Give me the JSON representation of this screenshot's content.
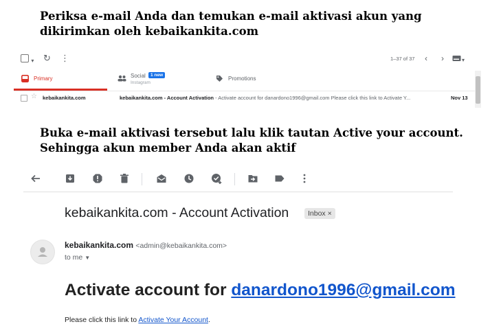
{
  "instructions": {
    "step1": "Periksa e-mail Anda dan temukan e-mail aktivasi akun yang dikirimkan oleh kebaikankita.com",
    "step2": "Buka e-mail aktivasi tersebut lalu klik tautan Active your account. Sehingga akun member Anda akan aktif"
  },
  "inbox": {
    "pagination": "1–37 of 37",
    "tabs": [
      {
        "label": "Primary"
      },
      {
        "label": "Social",
        "badge": "1 new",
        "sublabel": "Instagram"
      },
      {
        "label": "Promotions"
      }
    ],
    "row": {
      "sender": "kebaikankita.com",
      "subject": "kebaikankita.com - Account Activation",
      "snippet": " - Activate account for danardono1996@gmail.com Please click this link to Activate Y...",
      "date": "Nov 13"
    },
    "colors": {
      "primary_tab": "#d93025",
      "badge": "#1a73e8"
    }
  },
  "email": {
    "subject": "kebaikankita.com - Account Activation",
    "label": "Inbox",
    "label_close": "×",
    "sender_name": "kebaikankita.com",
    "sender_email": "<admin@kebaikankita.com>",
    "to": "to me",
    "headline_prefix": "Activate account for ",
    "headline_email": "danardono1996@gmail.com",
    "body_prefix": "Please click this link to ",
    "body_link": "Activate Your Account",
    "body_suffix": ".",
    "link_color": "#1155cc"
  },
  "toolbar_icons": [
    "back-arrow-icon",
    "archive-icon",
    "report-spam-icon",
    "delete-icon",
    "mark-unread-icon",
    "snooze-icon",
    "add-to-tasks-icon",
    "move-to-icon",
    "label-icon",
    "more-vert-icon"
  ]
}
